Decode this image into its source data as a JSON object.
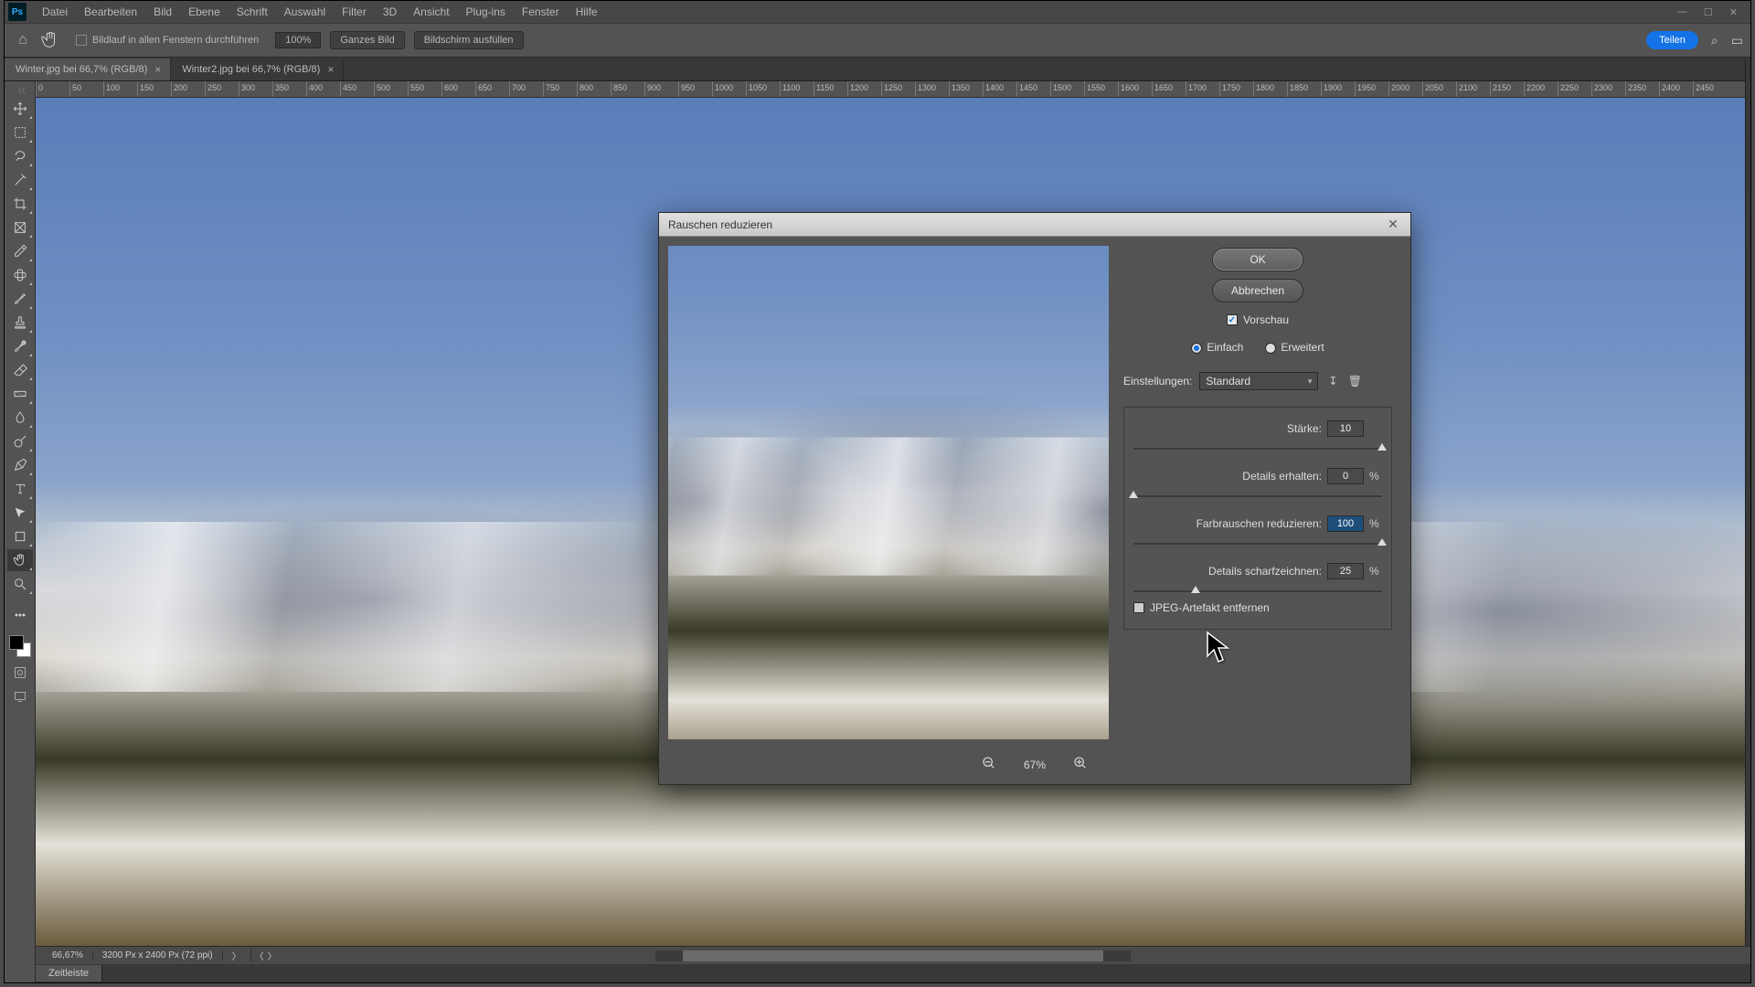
{
  "menu": {
    "items": [
      "Datei",
      "Bearbeiten",
      "Bild",
      "Ebene",
      "Schrift",
      "Auswahl",
      "Filter",
      "3D",
      "Ansicht",
      "Plug-ins",
      "Fenster",
      "Hilfe"
    ]
  },
  "optionbar": {
    "scroll_all_label": "Bildlauf in allen Fenstern durchführen",
    "zoom": "100%",
    "fit_label": "Ganzes Bild",
    "fill_label": "Bildschirm ausfüllen",
    "share_label": "Teilen"
  },
  "tabs": [
    {
      "label": "Winter.jpg bei 66,7% (RGB/8)",
      "active": true
    },
    {
      "label": "Winter2.jpg bei 66,7% (RGB/8)",
      "active": false
    }
  ],
  "ruler_ticks": [
    "0",
    "50",
    "100",
    "150",
    "200",
    "250",
    "300",
    "350",
    "400",
    "450",
    "500",
    "550",
    "600",
    "650",
    "700",
    "750",
    "800",
    "850",
    "900",
    "950",
    "1000",
    "1050",
    "1100",
    "1150",
    "1200",
    "1250",
    "1300",
    "1350",
    "1400",
    "1450",
    "1500",
    "1550",
    "1600",
    "1650",
    "1700",
    "1750",
    "1800",
    "1850",
    "1900",
    "1950",
    "2000",
    "2050",
    "2100",
    "2150",
    "2200",
    "2250",
    "2300",
    "2350",
    "2400",
    "2450"
  ],
  "status": {
    "zoom": "66,67%",
    "docinfo": "3200 Px x 2400 Px (72 ppi)"
  },
  "timeline_label": "Zeitleiste",
  "dialog": {
    "title": "Rauschen reduzieren",
    "ok": "OK",
    "cancel": "Abbrechen",
    "preview_label": "Vorschau",
    "mode_basic": "Einfach",
    "mode_advanced": "Erweitert",
    "settings_label": "Einstellungen:",
    "settings_value": "Standard",
    "sliders": {
      "strength": {
        "label": "Stärke:",
        "value": "10",
        "unit": "",
        "pos": 100
      },
      "preserve": {
        "label": "Details erhalten:",
        "value": "0",
        "unit": "%",
        "pos": 0
      },
      "color": {
        "label": "Farbrauschen reduzieren:",
        "value": "100",
        "unit": "%",
        "pos": 100,
        "selected": true
      },
      "sharpen": {
        "label": "Details scharfzeichnen:",
        "value": "25",
        "unit": "%",
        "pos": 25
      }
    },
    "jpeg_label": "JPEG-Artefakt entfernen",
    "preview_zoom": "67%"
  }
}
